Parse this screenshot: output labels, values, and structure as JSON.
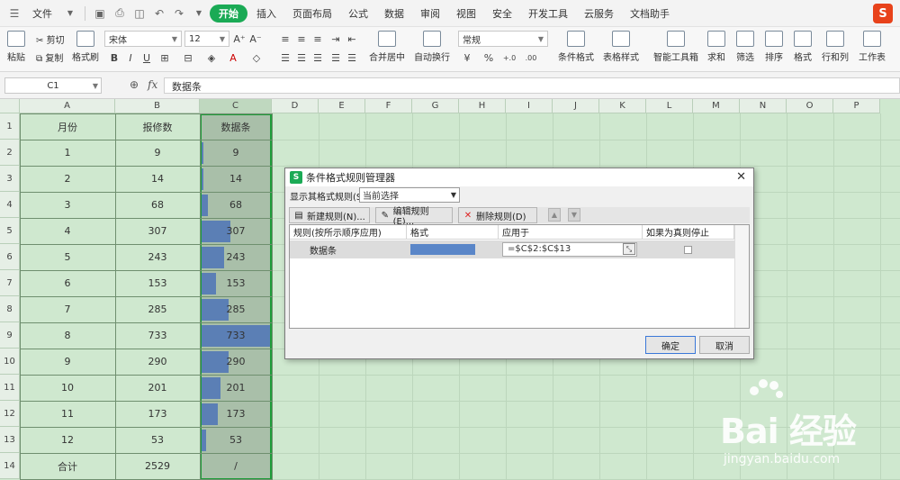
{
  "menu": {
    "file": "文件",
    "tabs": [
      "开始",
      "插入",
      "页面布局",
      "公式",
      "数据",
      "审阅",
      "视图",
      "安全",
      "开发工具",
      "云服务",
      "文档助手"
    ],
    "active_tab": "开始"
  },
  "ribbon": {
    "paste": "粘贴",
    "cut": "剪切",
    "copy": "复制",
    "format_painter": "格式刷",
    "font_name": "宋体",
    "font_size": "12",
    "merge_center": "合并居中",
    "wrap_text": "自动换行",
    "number_format": "常规",
    "conditional_format": "条件格式",
    "table_style": "表格样式",
    "smart_tools": "智能工具箱",
    "sum": "求和",
    "filter": "筛选",
    "sort": "排序",
    "format": "格式",
    "row_col": "行和列",
    "worksheet": "工作表",
    "bold": "B",
    "italic": "I",
    "underline": "U",
    "font_color": "A",
    "percent": "%",
    "dec_inc": "+.0",
    "dec_dec": ".00"
  },
  "formula_bar": {
    "cell_ref": "C1",
    "fx": "fx",
    "value": "数据条"
  },
  "sheet": {
    "columns": [
      "A",
      "B",
      "C",
      "D",
      "E",
      "F",
      "G",
      "H",
      "I",
      "J",
      "K",
      "L",
      "M",
      "N",
      "O",
      "P"
    ],
    "rows": [
      "1",
      "2",
      "3",
      "4",
      "5",
      "6",
      "7",
      "8",
      "9",
      "10",
      "11",
      "12",
      "13",
      "14"
    ],
    "header": [
      "月份",
      "报修数",
      "数据条"
    ],
    "data": [
      {
        "month": "1",
        "count": "9",
        "bar": "9"
      },
      {
        "month": "2",
        "count": "14",
        "bar": "14"
      },
      {
        "month": "3",
        "count": "68",
        "bar": "68"
      },
      {
        "month": "4",
        "count": "307",
        "bar": "307"
      },
      {
        "month": "5",
        "count": "243",
        "bar": "243"
      },
      {
        "month": "6",
        "count": "153",
        "bar": "153"
      },
      {
        "month": "7",
        "count": "285",
        "bar": "285"
      },
      {
        "month": "8",
        "count": "733",
        "bar": "733"
      },
      {
        "month": "9",
        "count": "290",
        "bar": "290"
      },
      {
        "month": "10",
        "count": "201",
        "bar": "201"
      },
      {
        "month": "11",
        "count": "173",
        "bar": "173"
      },
      {
        "month": "12",
        "count": "53",
        "bar": "53"
      }
    ],
    "total": {
      "label": "合计",
      "count": "2529",
      "bar": "/"
    },
    "bar_color": "#5b7fb5"
  },
  "dialog": {
    "title": "条件格式规则管理器",
    "show_label": "显示其格式规则(S):",
    "show_value": "当前选择",
    "new_rule": "新建规则(N)...",
    "edit_rule": "编辑规则(E)...",
    "delete_rule": "删除规则(D)",
    "col_rule": "规则(按所示顺序应用)",
    "col_format": "格式",
    "col_applies": "应用于",
    "col_stop": "如果为真则停止",
    "rule_name": "数据条",
    "rule_applies": "=$C$2:$C$13",
    "ok": "确定",
    "cancel": "取消"
  },
  "watermark": {
    "brand": "Bai 经验",
    "url": "jingyan.baidu.com"
  }
}
